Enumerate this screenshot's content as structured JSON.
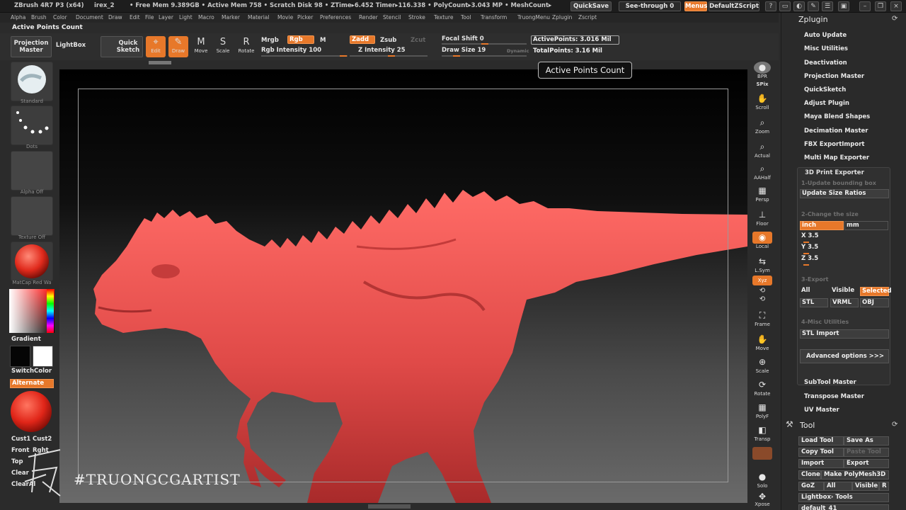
{
  "title_bar": {
    "app": "ZBrush 4R7 P3 (x64)",
    "document": "irex_2",
    "stats": "• Free Mem 9.389GB • Active Mem 758 • Scratch Disk 98 • ZTime▸6.452 Timer▸116.338 • PolyCount▸3.043 MP • MeshCount▸",
    "quicksave": "QuickSave",
    "see_through": "See-through  0",
    "menus": "Menus",
    "script": "DefaultZScript"
  },
  "menu_bar": [
    "Alpha",
    "Brush",
    "Color",
    "Document",
    "Draw",
    "Edit",
    "File",
    "Layer",
    "Light",
    "Macro",
    "Marker",
    "Material",
    "Movie",
    "Picker",
    "Preferences",
    "Render",
    "Stencil",
    "Stroke",
    "Texture",
    "Tool",
    "Transform",
    "TruongMenu",
    "Zplugin",
    "Zscript"
  ],
  "breadcrumb": "Active Points Count",
  "toolbar": {
    "projection_master": "Projection Master",
    "lightbox": "LightBox",
    "quick_sketch": "Quick Sketch",
    "edit": "Edit",
    "draw": "Draw",
    "move": "Move",
    "scale": "Scale",
    "rotate": "Rotate",
    "mrgb": "Mrgb",
    "rgb": "Rgb",
    "m": "M",
    "rgb_intensity": "Rgb Intensity 100",
    "zadd": "Zadd",
    "zsub": "Zsub",
    "zcut": "Zcut",
    "z_intensity": "Z Intensity 25",
    "focal_shift": "Focal Shift 0",
    "draw_size": "Draw Size 19",
    "dynamic": "Dynamic",
    "active_points": "ActivePoints: 3.016 Mil",
    "total_points": "TotalPoints: 3.16 Mil"
  },
  "tooltip": "Active Points Count",
  "left_shelf": {
    "brush_label": "Standard",
    "stroke_label": "Dots",
    "alpha_label": "Alpha Off",
    "texture_label": "Texture Off",
    "material_label": "MatCap Red Wa",
    "gradient": "Gradient",
    "switch_color": "SwitchColor",
    "alternate": "Alternate",
    "cust1": "Cust1",
    "cust2": "Cust2",
    "front": "Front",
    "right": "Rght",
    "top": "Top",
    "clear": "Clear",
    "clear_all": "ClearAl"
  },
  "right_shelf": [
    "BPR",
    "SPix",
    "Scroll",
    "Zoom",
    "Actual",
    "AAHalf",
    "Persp",
    "Floor",
    "Local",
    "L.Sym",
    "Xyz",
    "Frame",
    "Move",
    "Scale",
    "Rotate",
    "PolyF",
    "Transp",
    "Solo",
    "Xpose"
  ],
  "zplugin": {
    "title": "Zplugin",
    "items": [
      "Auto Update",
      "Misc Utilities",
      "Deactivation",
      "Projection Master",
      "QuickSketch",
      "Adjust Plugin",
      "Maya Blend Shapes",
      "Decimation Master",
      "FBX ExportImport",
      "Multi Map Exporter"
    ],
    "print_exporter": {
      "title": "3D Print Exporter",
      "step1": "1-Update bounding box",
      "update_size": "Update Size Ratios",
      "step2": "2-Change the size",
      "inch": "inch",
      "mm": "mm",
      "x": "X 3.5",
      "y": "Y 3.5",
      "z": "Z 3.5",
      "step3": "3-Export",
      "all": "All",
      "visible": "Visible",
      "selected": "Selected",
      "stl": "STL",
      "vrml": "VRML",
      "obj": "OBJ",
      "step4": "4-Misc Utilities",
      "stl_import": "STL Import",
      "advanced": "Advanced options >>>"
    },
    "after_items": [
      "SubTool Master",
      "Transpose Master",
      "UV Master"
    ]
  },
  "tool": {
    "title": "Tool",
    "load_tool": "Load Tool",
    "save_as": "Save As",
    "copy_tool": "Copy Tool",
    "paste_tool": "Paste Tool",
    "import": "Import",
    "export": "Export",
    "clone": "Clone",
    "make_polymesh": "Make PolyMesh3D",
    "goz": "GoZ",
    "all": "All",
    "visible": "Visible",
    "r": "R",
    "lightbox_tools": "Lightbox› Tools",
    "default": "default_41"
  },
  "watermark": "#TRUONGCGARTIST",
  "colors": {
    "accent": "#e7782a",
    "model": "#e04a48"
  }
}
